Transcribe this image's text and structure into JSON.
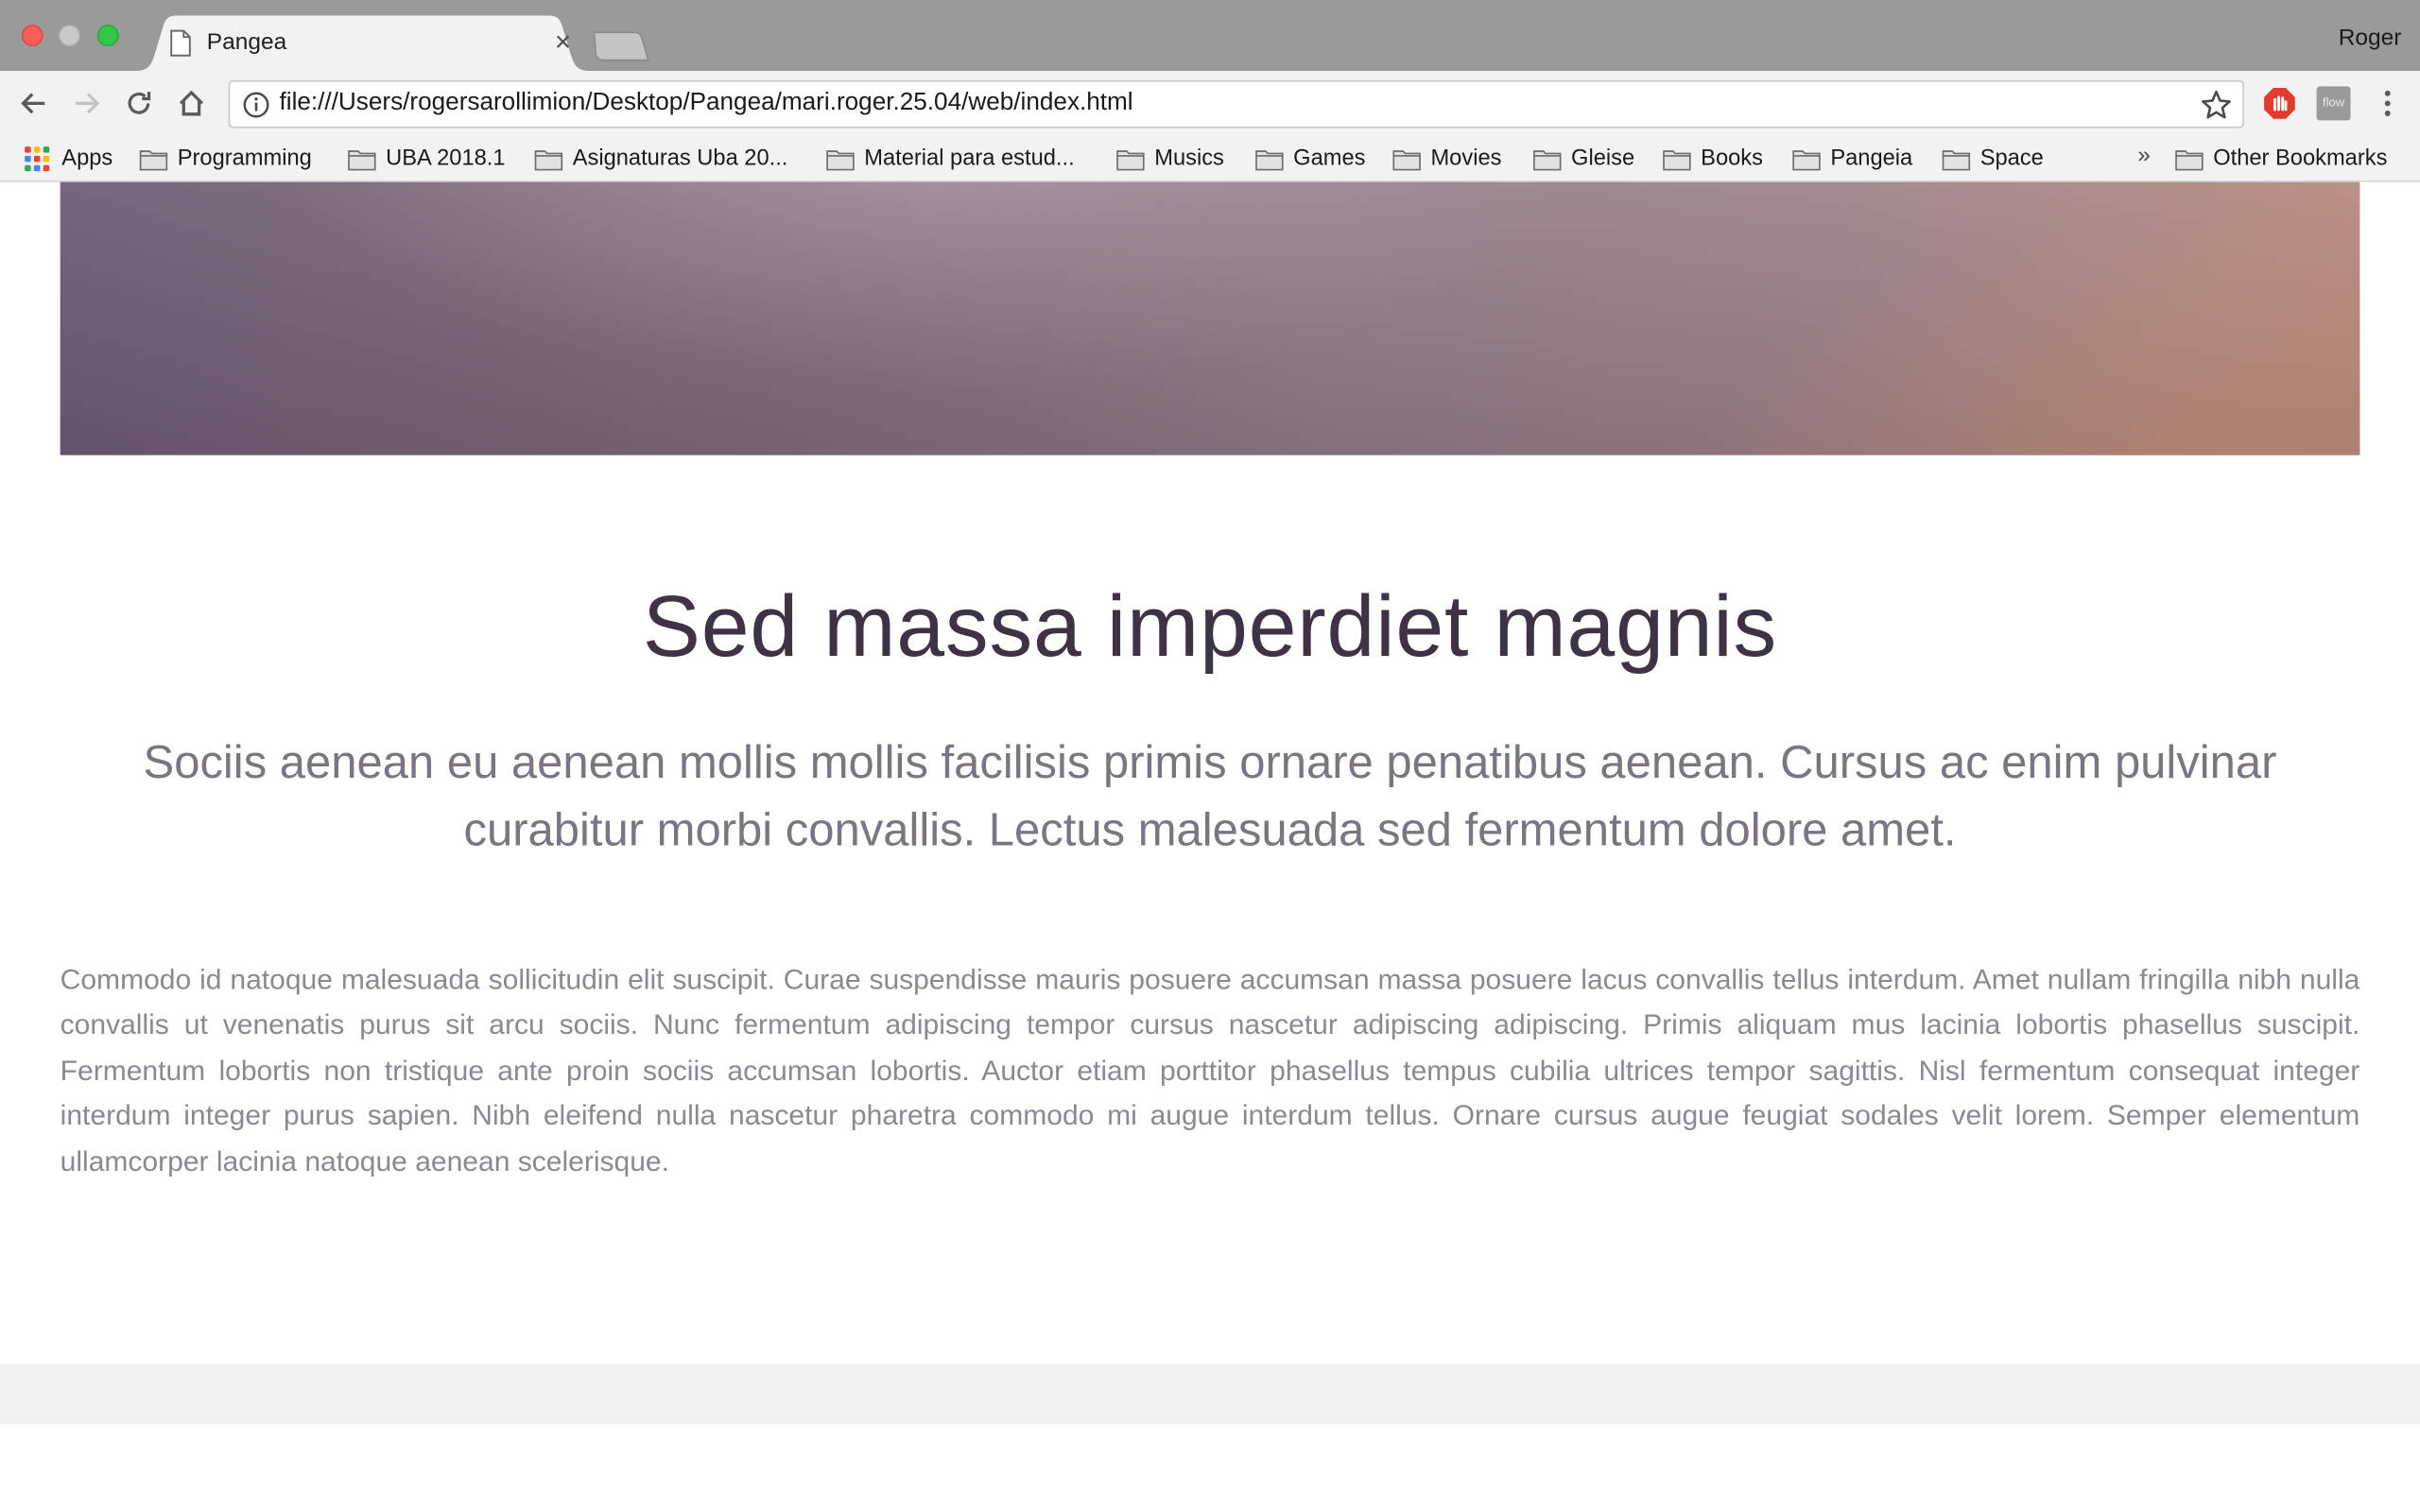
{
  "browser": {
    "tab_title": "Pangea",
    "tab_close": "×",
    "profile_name": "Roger",
    "url": "file:///Users/rogersarollimion/Desktop/Pangea/mari.roger.25.04/web/index.html",
    "extension_label": "flow"
  },
  "bookmarks": {
    "apps": "Apps",
    "items": [
      "Programming",
      "UBA 2018.1",
      "Asignaturas Uba 20...",
      "Material para estud...",
      "Musics",
      "Games",
      "Movies",
      "Gleise",
      "Books",
      "Pangeia",
      "Space"
    ],
    "overflow": "»",
    "other": "Other Bookmarks"
  },
  "page": {
    "heading": "Sed massa imperdiet magnis",
    "subtitle": "Sociis aenean eu aenean mollis mollis facilisis primis ornare penatibus aenean. Cursus ac enim pulvinar curabitur morbi convallis. Lectus malesuada sed fermentum dolore amet.",
    "body": "Commodo id natoque malesuada sollicitudin elit suscipit. Curae suspendisse mauris posuere accumsan massa posuere lacus convallis tellus interdum. Amet nullam fringilla nibh nulla convallis ut venenatis purus sit arcu sociis. Nunc fermentum adipiscing tempor cursus nascetur adipiscing adipiscing. Primis aliquam mus lacinia lobortis phasellus suscipit. Fermentum lobortis non tristique ante proin sociis accumsan lobortis. Auctor etiam porttitor phasellus tempus cubilia ultrices tempor sagittis. Nisl fermentum consequat integer interdum integer purus sapien. Nibh eleifend nulla nascetur pharetra commodo mi augue interdum tellus. Ornare cursus augue feugiat sodales velit lorem. Semper elementum ullamcorper lacinia natoque aenean scelerisque."
  },
  "colors": {
    "heading": "#3e3245",
    "subtitle": "#7a7580",
    "body": "#8b8891",
    "footer_band": "#eff1f2"
  }
}
